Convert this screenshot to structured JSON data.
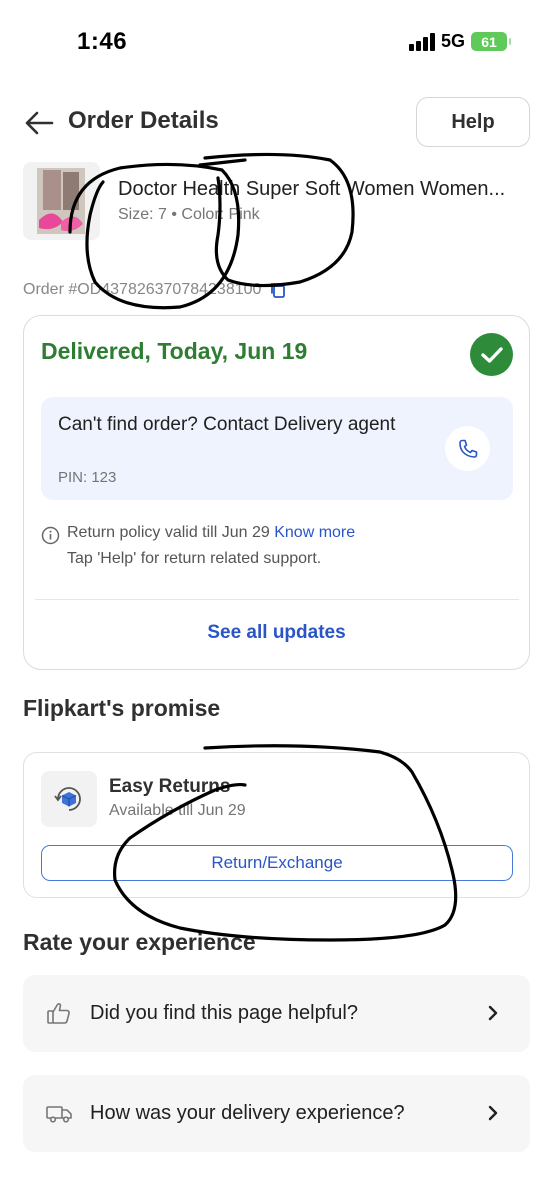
{
  "status_bar": {
    "time": "1:46",
    "network": "5G",
    "battery": "61"
  },
  "header": {
    "title": "Order Details",
    "help_label": "Help"
  },
  "product": {
    "name": "Doctor Health Super Soft Women Women...",
    "meta": "Size: 7 • Color: Pink",
    "order_id": "Order #OD437826370784238100"
  },
  "delivery": {
    "status": "Delivered, Today, Jun 19",
    "contact_text": "Can't find order? Contact Delivery agent",
    "pin": "PIN: 123",
    "return_policy": "Return policy valid till Jun 29",
    "know_more": "Know more",
    "help_note": "Tap 'Help' for return related support.",
    "see_all": "See all updates"
  },
  "promise": {
    "title": "Flipkart's promise",
    "easy_returns": "Easy Returns",
    "available_till": "Available till Jun 29",
    "return_button": "Return/Exchange"
  },
  "rate": {
    "title": "Rate your experience",
    "rows": [
      {
        "label": "Did you find this page helpful?",
        "icon": "thumbs-up-icon"
      },
      {
        "label": "How was your delivery experience?",
        "icon": "delivery-truck-icon"
      }
    ]
  },
  "colors": {
    "delivered_green": "#2e7d32",
    "link_blue": "#2a55c7",
    "contact_bg": "#eef3fd"
  }
}
